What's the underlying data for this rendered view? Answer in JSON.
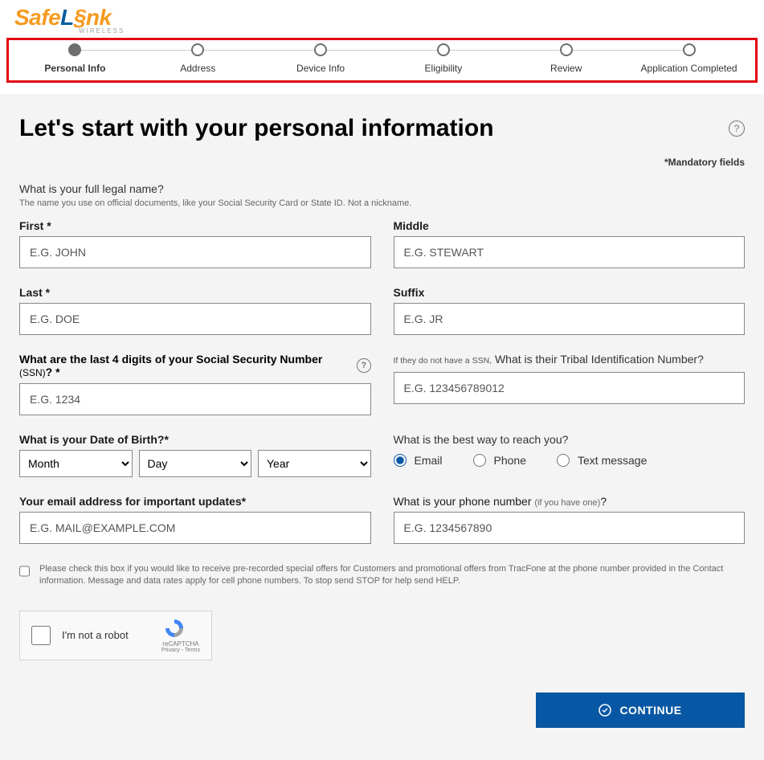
{
  "logo": {
    "safe": "Safe",
    "l": "L",
    "i": "§",
    "nk": "nk",
    "sub": "WIRELESS"
  },
  "stepper": [
    {
      "label": "Personal Info",
      "active": true
    },
    {
      "label": "Address",
      "active": false
    },
    {
      "label": "Device Info",
      "active": false
    },
    {
      "label": "Eligibility",
      "active": false
    },
    {
      "label": "Review",
      "active": false
    },
    {
      "label": "Application Completed",
      "active": false
    }
  ],
  "heading": "Let's start with your personal information",
  "mandatory": "*Mandatory fields",
  "name_section": {
    "question": "What is your full legal name?",
    "hint": "The name you use on official documents, like your Social Security Card or State ID. Not a nickname."
  },
  "fields": {
    "first": {
      "label": "First *",
      "placeholder": "E.G. JOHN"
    },
    "middle": {
      "label": "Middle",
      "placeholder": "E.G. STEWART"
    },
    "last": {
      "label": "Last  *",
      "placeholder": "E.G. DOE"
    },
    "suffix": {
      "label": "Suffix",
      "placeholder": "E.G. JR"
    },
    "ssn": {
      "label": "What are the last 4 digits of your Social Security Number",
      "paren": "(SSN)",
      "suffix": "? *",
      "placeholder": "E.G. 1234"
    },
    "tribal": {
      "prefix": "If they do not have a SSN,",
      "label": " What is their Tribal Identification Number?",
      "placeholder": "E.G. 123456789012"
    },
    "dob": {
      "label": "What is your Date of Birth?*",
      "month": "Month",
      "day": "Day",
      "year": "Year"
    },
    "email": {
      "label": "Your email address for important updates*",
      "placeholder": "E.G. MAIL@EXAMPLE.COM"
    },
    "phone": {
      "label": "What is your phone number ",
      "suffix": "(if you have one)",
      "tail": "?",
      "placeholder": "E.G. 1234567890"
    }
  },
  "reach": {
    "label": "What is the best way to reach you?",
    "options": {
      "email": "Email",
      "phone": "Phone",
      "text": "Text message"
    }
  },
  "consent": "Please check this box if you would like to receive pre-recorded special offers for Customers and promotional offers from TracFone at the phone number provided in the Contact information. Message and data rates apply for cell phone numbers. To stop send STOP for help send HELP.",
  "recaptcha": {
    "label": "I'm not a robot",
    "brand": "reCAPTCHA",
    "terms": "Privacy - Terms"
  },
  "continue": "CONTINUE"
}
